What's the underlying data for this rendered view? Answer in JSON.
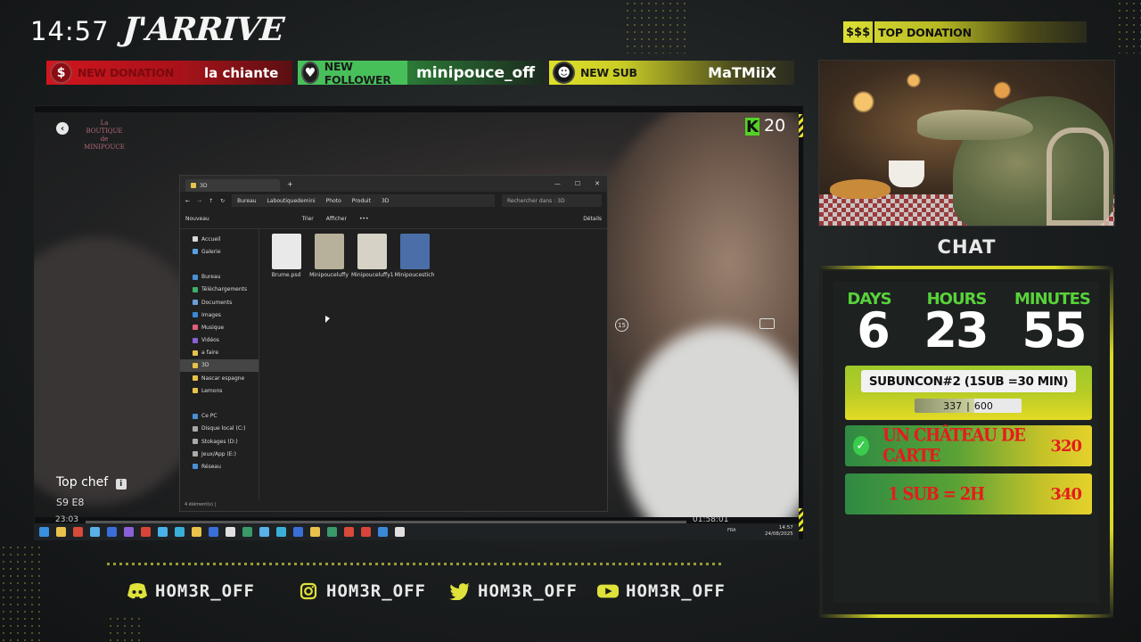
{
  "header": {
    "clock": "14:57",
    "brand": "J'ARRIVE"
  },
  "alerts": [
    {
      "tag": "NEW DONATION",
      "value": "la chiante",
      "icon": "dollar-icon"
    },
    {
      "tag": "NEW FOLLOWER",
      "value": "minipouce_off",
      "icon": "heart-icon"
    },
    {
      "tag": "NEW SUB",
      "value": "MaTMiiX",
      "icon": "users-icon"
    }
  ],
  "top_donation": {
    "mark": "$$$",
    "label": "TOP DONATION"
  },
  "video": {
    "logo_text": "La BOUTIQUE de MINIPOUCE",
    "k_badge": "K",
    "rating": "20",
    "title": "Top chef",
    "info": "i",
    "episode": "S9 E8",
    "replay": "15",
    "time_left": "23:03",
    "time_right": "01:58:01",
    "progress_percent": 0
  },
  "explorer": {
    "tab": "3D",
    "add_tab": "+",
    "window_buttons": [
      "—",
      "☐",
      "✕"
    ],
    "breadcrumbs": [
      "Bureau",
      "Laboutiquedemini",
      "Photo",
      "Produit",
      "3D"
    ],
    "search_placeholder": "Rechercher dans : 3D",
    "cmd": {
      "new": "Nouveau",
      "sort": "Trier",
      "view": "Afficher",
      "more": "•••",
      "details": "Détails"
    },
    "nav": [
      {
        "label": "Accueil",
        "color": "#d9d9d9"
      },
      {
        "label": "Galerie",
        "color": "#5aa0e0"
      },
      {
        "label": "",
        "color": ""
      },
      {
        "label": "Bureau",
        "color": "#4a8fd8"
      },
      {
        "label": "Téléchargements",
        "color": "#3fb06a"
      },
      {
        "label": "Documents",
        "color": "#6a9fd8"
      },
      {
        "label": "Images",
        "color": "#3a88d8"
      },
      {
        "label": "Musique",
        "color": "#e0607a"
      },
      {
        "label": "Vidéos",
        "color": "#8a60d8"
      },
      {
        "label": "a faire",
        "color": "#e8c24a"
      },
      {
        "label": "3D",
        "color": "#e8c24a",
        "selected": true
      },
      {
        "label": "Nascar espagne",
        "color": "#e8c24a"
      },
      {
        "label": "Lemons",
        "color": "#e8c24a"
      },
      {
        "label": "",
        "color": ""
      },
      {
        "label": "Ce PC",
        "color": "#4a8fd8"
      },
      {
        "label": "Disque local (C:)",
        "color": "#aaaaaa"
      },
      {
        "label": "Stokages (D:)",
        "color": "#aaaaaa"
      },
      {
        "label": "Jeux/App (E:)",
        "color": "#aaaaaa"
      },
      {
        "label": "Réseau",
        "color": "#4a8fd8"
      }
    ],
    "files": [
      {
        "name": "Brume.psd",
        "color": "#e9e9e9"
      },
      {
        "name": "Minipouceluffy",
        "color": "#b7b09a"
      },
      {
        "name": "Minipouceluffy1",
        "color": "#d6d2c6"
      },
      {
        "name": "Minipoucestich",
        "color": "#4a6fa8"
      }
    ],
    "status": "4 élément(s)  |"
  },
  "taskbar": {
    "lang": "FRA",
    "clock": "14:57",
    "date": "24/08/2025",
    "icons": [
      "#3a8fe0",
      "#e8c24a",
      "#d84a3a",
      "#5ab0e8",
      "#3a6ed8",
      "#8a60d8",
      "#d8443a",
      "#4ab0e8",
      "#3ab0d8",
      "#e8c24a",
      "#3a6ed8",
      "#e0e0e0",
      "#3a9a6a",
      "#5ab0e8",
      "#3ab0d8",
      "#3a6ed8",
      "#e8c24a",
      "#3a9a6a",
      "#d84a3a",
      "#d8443a",
      "#3a88d8",
      "#e0e0e0"
    ]
  },
  "chat": {
    "title": "CHAT"
  },
  "subathon": {
    "days_label": "DAYS",
    "days": "6",
    "hours_label": "HOURS",
    "hours": "23",
    "minutes_label": "MINUTES",
    "minutes": "55",
    "goal_title": "SUBUNCON#2 (1SUB =30 MIN)",
    "goal_current": "337",
    "goal_sep": "|",
    "goal_max": "600",
    "goal_fraction": 0.56,
    "goals": [
      {
        "text": "UN CHÂTEAU DE CARTE",
        "value": "320",
        "done": true
      },
      {
        "text": "1 SUB = 2H",
        "value": "340",
        "done": false
      }
    ]
  },
  "socials": [
    {
      "icon": "discord-icon",
      "handle": "HOM3R_OFF"
    },
    {
      "icon": "instagram-icon",
      "handle": "HOM3R_OFF"
    },
    {
      "icon": "twitter-icon",
      "handle": "HOM3R_OFF"
    },
    {
      "icon": "youtube-icon",
      "handle": "HOM3R_OFF"
    }
  ],
  "colors": {
    "accent": "#dfe23a",
    "green": "#58d23a",
    "red": "#e51c1c"
  }
}
